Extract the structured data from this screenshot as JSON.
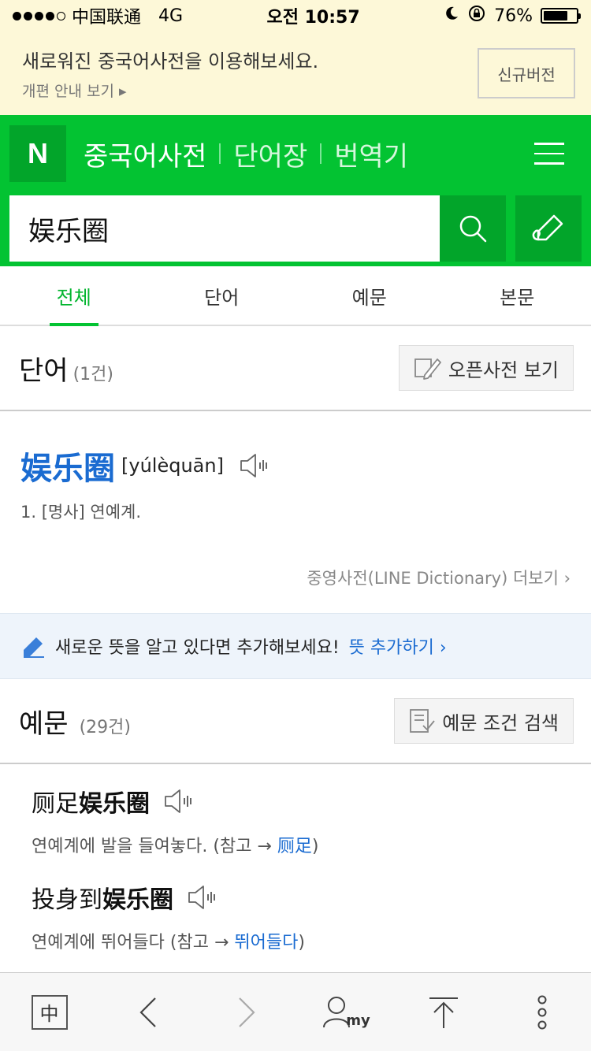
{
  "status": {
    "carrier": "中国联通",
    "network": "4G",
    "time": "오전 10:57",
    "battery": "76%",
    "battery_fraction": 0.76
  },
  "notice": {
    "title": "새로워진 중국어사전을 이용해보세요.",
    "link": "개편 안내 보기 ▸",
    "button": "신규버전"
  },
  "header": {
    "logo": "N",
    "nav": [
      "중국어사전",
      "단어장",
      "번역기"
    ],
    "search_value": "娱乐圈"
  },
  "tabs": [
    "전체",
    "단어",
    "예문",
    "본문"
  ],
  "word_section": {
    "title": "단어",
    "count": "(1건)",
    "button": "오픈사전 보기"
  },
  "entry": {
    "word": "娱乐圈",
    "pinyin": "[yúlèquān]",
    "definition": "1. [명사] 연예계.",
    "more": "중영사전(LINE Dictionary) 더보기 ›"
  },
  "suggest": {
    "text": "새로운 뜻을 알고 있다면 추가해보세요!",
    "link": "뜻 추가하기 ›"
  },
  "example_section": {
    "title": "예문",
    "count": "(29건)",
    "button": "예문 조건 검색"
  },
  "examples": [
    {
      "prefix": "厕足",
      "keyword": "娱乐圈",
      "translation": "연예계에 발을 들여놓다. (참고 → ",
      "ref": "厕足",
      "suffix": ")"
    },
    {
      "prefix": "投身到",
      "keyword": "娱乐圈",
      "translation": "연예계에 뛰어들다 (참고 → ",
      "ref": "뛰어들다",
      "suffix": ")"
    }
  ],
  "toolbar": {
    "zh_label": "中",
    "my_label": "my"
  },
  "colors": {
    "brand_green": "#03c332",
    "dark_green": "#02a52a",
    "link_blue": "#1a6bd1",
    "notice_bg": "#fdf8d8"
  }
}
